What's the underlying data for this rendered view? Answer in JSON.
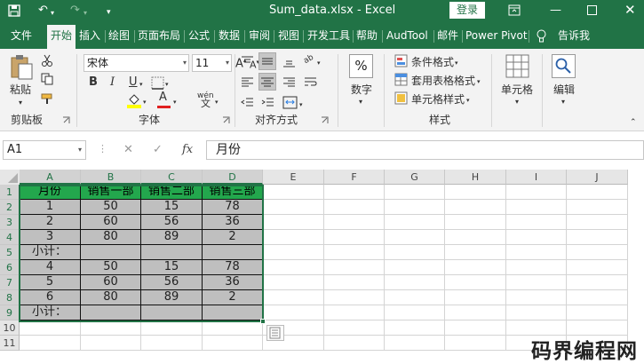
{
  "window": {
    "title": "Sum_data.xlsx  -  Excel",
    "login_label": "登录"
  },
  "ribbon_tabs": [
    "文件",
    "开始",
    "插入",
    "绘图",
    "页面布局",
    "公式",
    "数据",
    "审阅",
    "视图",
    "开发工具",
    "帮助",
    "AudTool",
    "邮件",
    "Power Pivot",
    "告诉我"
  ],
  "ribbon": {
    "clipboard": {
      "paste_label": "粘贴",
      "group_label": "剪贴板"
    },
    "font": {
      "font_name": "宋体",
      "font_size": "11",
      "group_label": "字体",
      "phonetic_label": "wén"
    },
    "alignment": {
      "group_label": "对齐方式"
    },
    "number": {
      "label": "数字",
      "percent": "%"
    },
    "styles": {
      "conditional": "条件格式",
      "table_format": "套用表格格式",
      "cell_styles": "单元格样式",
      "group_label": "样式"
    },
    "cells": {
      "label": "单元格"
    },
    "editing": {
      "label": "编辑"
    }
  },
  "formula_bar": {
    "name_box": "A1",
    "fx": "fx",
    "content": "月份"
  },
  "columns": [
    "A",
    "B",
    "C",
    "D",
    "E",
    "F",
    "G",
    "H",
    "I",
    "J"
  ],
  "rows": [
    "1",
    "2",
    "3",
    "4",
    "5",
    "6",
    "7",
    "8",
    "9",
    "10",
    "11"
  ],
  "table": [
    [
      "月份",
      "销售一部",
      "销售二部",
      "销售三部"
    ],
    [
      "1",
      "50",
      "15",
      "78"
    ],
    [
      "2",
      "60",
      "56",
      "36"
    ],
    [
      "3",
      "80",
      "89",
      "2"
    ],
    [
      "小计：",
      "",
      "",
      ""
    ],
    [
      "4",
      "50",
      "15",
      "78"
    ],
    [
      "5",
      "60",
      "56",
      "36"
    ],
    [
      "6",
      "80",
      "89",
      "2"
    ],
    [
      "小计：",
      "",
      "",
      ""
    ]
  ],
  "watermark": "码界编程网",
  "colors": {
    "accent": "#217346",
    "header_fill": "#23a74d",
    "data_fill": "#bfbfbf"
  }
}
